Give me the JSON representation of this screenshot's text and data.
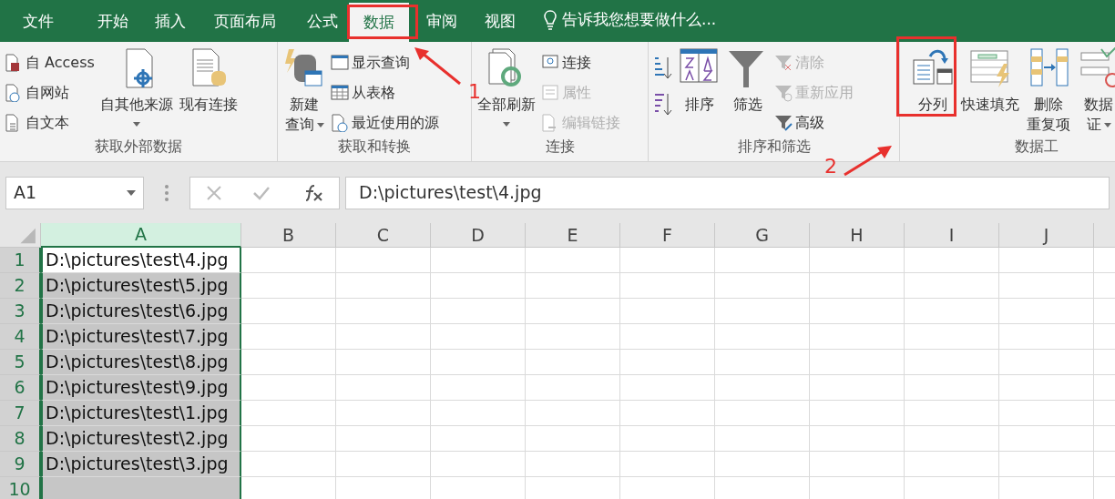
{
  "tabs": [
    {
      "label": "文件",
      "selected": false
    },
    {
      "label": "开始",
      "selected": false
    },
    {
      "label": "插入",
      "selected": false
    },
    {
      "label": "页面布局",
      "selected": false
    },
    {
      "label": "公式",
      "selected": false
    },
    {
      "label": "数据",
      "selected": true
    },
    {
      "label": "审阅",
      "selected": false
    },
    {
      "label": "视图",
      "selected": false
    }
  ],
  "tell_me": {
    "placeholder": "告诉我您想要做什么..."
  },
  "ribbon_groups": [
    {
      "label": "获取外部数据",
      "items": [
        {
          "kind": "stack",
          "buttons": [
            {
              "label": "自 Access",
              "disabled": false
            },
            {
              "label": "自网站",
              "disabled": false
            },
            {
              "label": "自文本",
              "disabled": false
            }
          ]
        },
        {
          "kind": "large",
          "lines": [
            "自其他来源"
          ],
          "dropdown": true
        },
        {
          "kind": "large",
          "lines": [
            "现有连接"
          ],
          "dropdown": false
        }
      ]
    },
    {
      "label": "获取和转换",
      "items": [
        {
          "kind": "large",
          "lines": [
            "新建",
            "查询"
          ],
          "dropdown": true
        },
        {
          "kind": "stack",
          "buttons": [
            {
              "label": "显示查询",
              "disabled": false
            },
            {
              "label": "从表格",
              "disabled": false
            },
            {
              "label": "最近使用的源",
              "disabled": false
            }
          ]
        }
      ]
    },
    {
      "label": "连接",
      "items": [
        {
          "kind": "large",
          "lines": [
            "全部刷新"
          ],
          "dropdown": true
        },
        {
          "kind": "stack",
          "buttons": [
            {
              "label": "连接",
              "disabled": false
            },
            {
              "label": "属性",
              "disabled": true
            },
            {
              "label": "编辑链接",
              "disabled": true
            }
          ]
        }
      ]
    },
    {
      "label": "排序和筛选",
      "items": [
        {
          "kind": "sortpair"
        },
        {
          "kind": "large",
          "lines": [
            "排序"
          ],
          "dropdown": false
        },
        {
          "kind": "large",
          "lines": [
            "筛选"
          ],
          "dropdown": false
        },
        {
          "kind": "stack",
          "buttons": [
            {
              "label": "清除",
              "disabled": true
            },
            {
              "label": "重新应用",
              "disabled": true
            },
            {
              "label": "高级",
              "disabled": false
            }
          ]
        }
      ]
    },
    {
      "label": "数据工",
      "items": [
        {
          "kind": "large",
          "lines": [
            "分列"
          ],
          "dropdown": false
        },
        {
          "kind": "large",
          "lines": [
            "快速填充"
          ],
          "dropdown": false
        },
        {
          "kind": "large",
          "lines": [
            "删除",
            "重复项"
          ],
          "dropdown": false
        },
        {
          "kind": "large",
          "lines": [
            "数据",
            "证"
          ],
          "dropdown": true
        }
      ]
    }
  ],
  "formula_bar": {
    "name_box": "A1",
    "value": "D:\\pictures\\test\\4.jpg"
  },
  "columns": [
    {
      "label": "A",
      "selected": true
    },
    {
      "label": "B",
      "selected": false
    },
    {
      "label": "C",
      "selected": false
    },
    {
      "label": "D",
      "selected": false
    },
    {
      "label": "E",
      "selected": false
    },
    {
      "label": "F",
      "selected": false
    },
    {
      "label": "G",
      "selected": false
    },
    {
      "label": "H",
      "selected": false
    },
    {
      "label": "I",
      "selected": false
    },
    {
      "label": "J",
      "selected": false
    }
  ],
  "rows": [
    {
      "number": "1",
      "value": "D:\\pictures\\test\\4.jpg",
      "selected": true,
      "active": true
    },
    {
      "number": "2",
      "value": "D:\\pictures\\test\\5.jpg",
      "selected": true,
      "active": false
    },
    {
      "number": "3",
      "value": "D:\\pictures\\test\\6.jpg",
      "selected": true,
      "active": false
    },
    {
      "number": "4",
      "value": "D:\\pictures\\test\\7.jpg",
      "selected": true,
      "active": false
    },
    {
      "number": "5",
      "value": "D:\\pictures\\test\\8.jpg",
      "selected": true,
      "active": false
    },
    {
      "number": "6",
      "value": "D:\\pictures\\test\\9.jpg",
      "selected": true,
      "active": false
    },
    {
      "number": "7",
      "value": "D:\\pictures\\test\\1.jpg",
      "selected": true,
      "active": false
    },
    {
      "number": "8",
      "value": "D:\\pictures\\test\\2.jpg",
      "selected": true,
      "active": false
    },
    {
      "number": "9",
      "value": "D:\\pictures\\test\\3.jpg",
      "selected": true,
      "active": false
    },
    {
      "number": "10",
      "value": "",
      "selected": true,
      "active": false
    }
  ],
  "annotations": [
    {
      "label": "1"
    },
    {
      "label": "2"
    }
  ]
}
